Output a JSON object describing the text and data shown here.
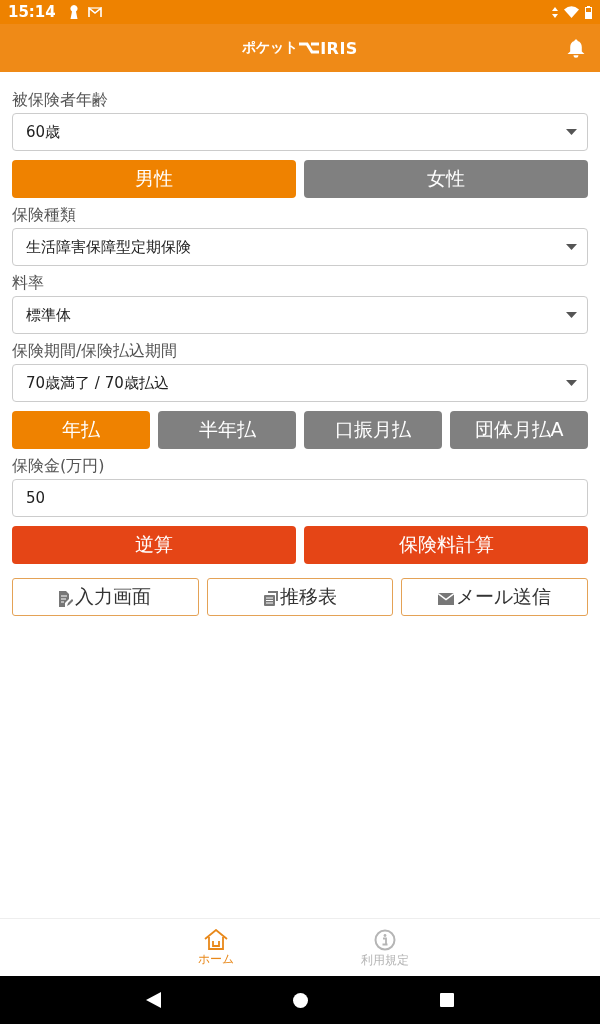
{
  "status_bar": {
    "time": "15:14"
  },
  "header": {
    "logo_prefix": "ポケット",
    "logo_name": "IRIS"
  },
  "form": [
    {
      "kind": "dropdown",
      "label": "被保険者年齢",
      "value": "60歳"
    },
    {
      "kind": "toggle",
      "options": [
        {
          "label": "男性",
          "selected": true
        },
        {
          "label": "女性",
          "selected": false
        }
      ]
    },
    {
      "kind": "dropdown",
      "label": "保険種類",
      "value": "生活障害保障型定期保険"
    },
    {
      "kind": "dropdown",
      "label": "料率",
      "value": "標準体"
    },
    {
      "kind": "dropdown",
      "label": "保険期間/保険払込期間",
      "value": "70歳満了 / 70歳払込"
    },
    {
      "kind": "toggle",
      "options": [
        {
          "label": "年払",
          "selected": true
        },
        {
          "label": "半年払",
          "selected": false
        },
        {
          "label": "口振月払",
          "selected": false
        },
        {
          "label": "団体月払A",
          "selected": false
        }
      ]
    },
    {
      "kind": "input",
      "label": "保険金(万円)",
      "value": "50"
    }
  ],
  "actions": [
    {
      "label": "逆算"
    },
    {
      "label": "保険料計算"
    }
  ],
  "tools": [
    {
      "label": "入力画面"
    },
    {
      "label": "推移表"
    },
    {
      "label": "メール送信"
    }
  ],
  "bottom_nav": [
    {
      "label": "ホーム",
      "selected": true
    },
    {
      "label": "利用規定",
      "selected": false
    }
  ]
}
